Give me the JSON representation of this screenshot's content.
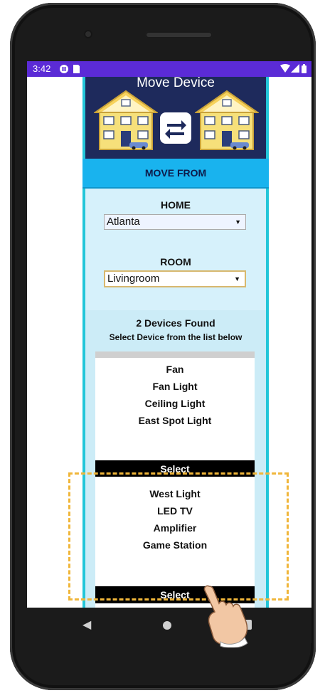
{
  "status_bar": {
    "time": "3:42"
  },
  "app": {
    "header_title": "Move Device",
    "section_title": "MOVE FROM",
    "home_label": "HOME",
    "home_selected": "Atlanta",
    "room_label": "ROOM",
    "room_selected": "Livingroom",
    "devices_found": "2 Devices Found",
    "instruction": "Select Device from the list below",
    "device_lists": [
      {
        "items": [
          "Fan",
          "Fan Light",
          "Ceiling Light",
          "East Spot Light"
        ],
        "button": "Select"
      },
      {
        "items": [
          "West Light",
          "LED TV",
          "Amplifier",
          "Game Station"
        ],
        "button": "Select"
      }
    ]
  },
  "colors": {
    "status_bar": "#5b2bd6",
    "header_bg": "#1e2a5c",
    "section_title_bg": "#19b3ee",
    "panel_bg": "#ccecf7",
    "highlight": "#f0b63a"
  },
  "icons": [
    "pause-circle-icon",
    "sim-card-icon",
    "wifi-icon",
    "cell-signal-icon",
    "battery-icon",
    "house-icon",
    "swap-arrows-icon",
    "back-icon",
    "home-nav-icon",
    "recents-icon",
    "pointing-hand-icon"
  ]
}
